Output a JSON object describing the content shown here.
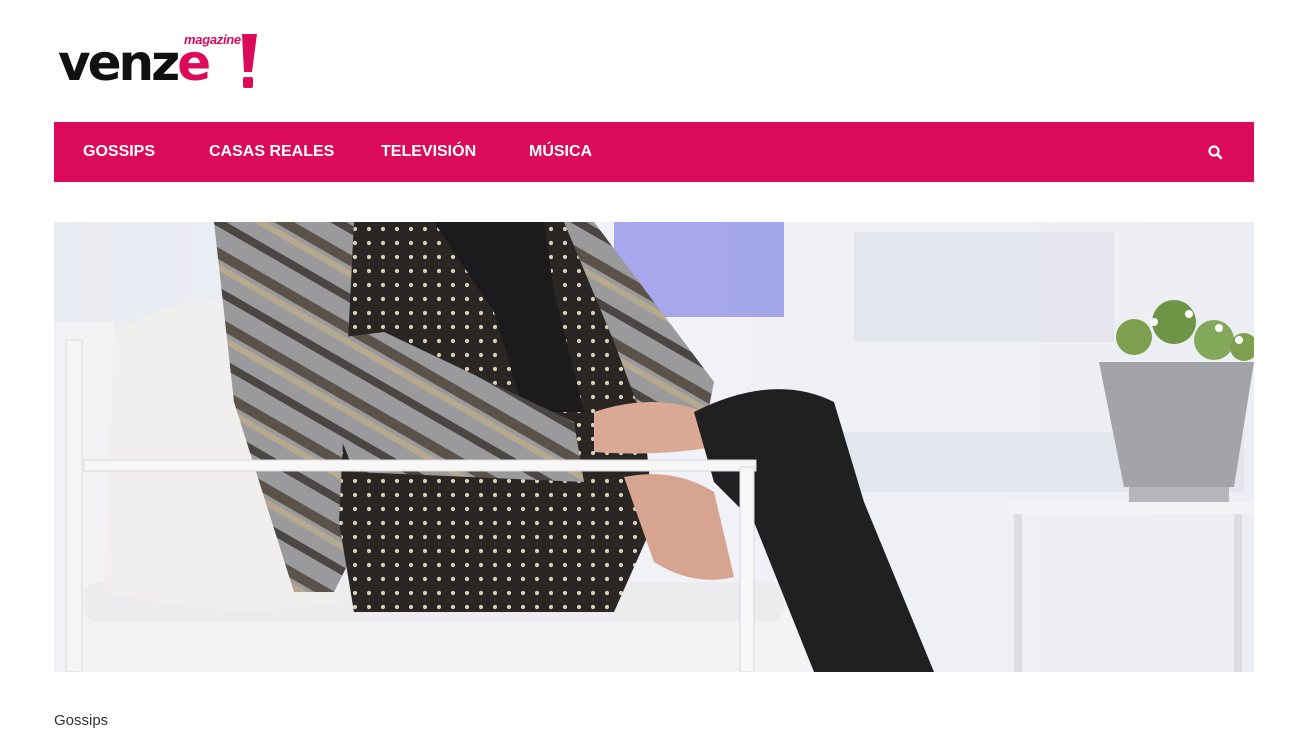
{
  "brand": {
    "name_main": "venze",
    "name_tagline": "magazine",
    "accent_color": "#dc0a5a"
  },
  "nav": {
    "items": [
      {
        "label": "GOSSIPS"
      },
      {
        "label": "CASAS REALES"
      },
      {
        "label": "TELEVISIÓN"
      },
      {
        "label": "MÚSICA"
      }
    ],
    "search_icon": "search-icon"
  },
  "hero": {
    "image": "woman-seated-on-white-sofa-photo"
  },
  "article": {
    "category": "Gossips"
  }
}
